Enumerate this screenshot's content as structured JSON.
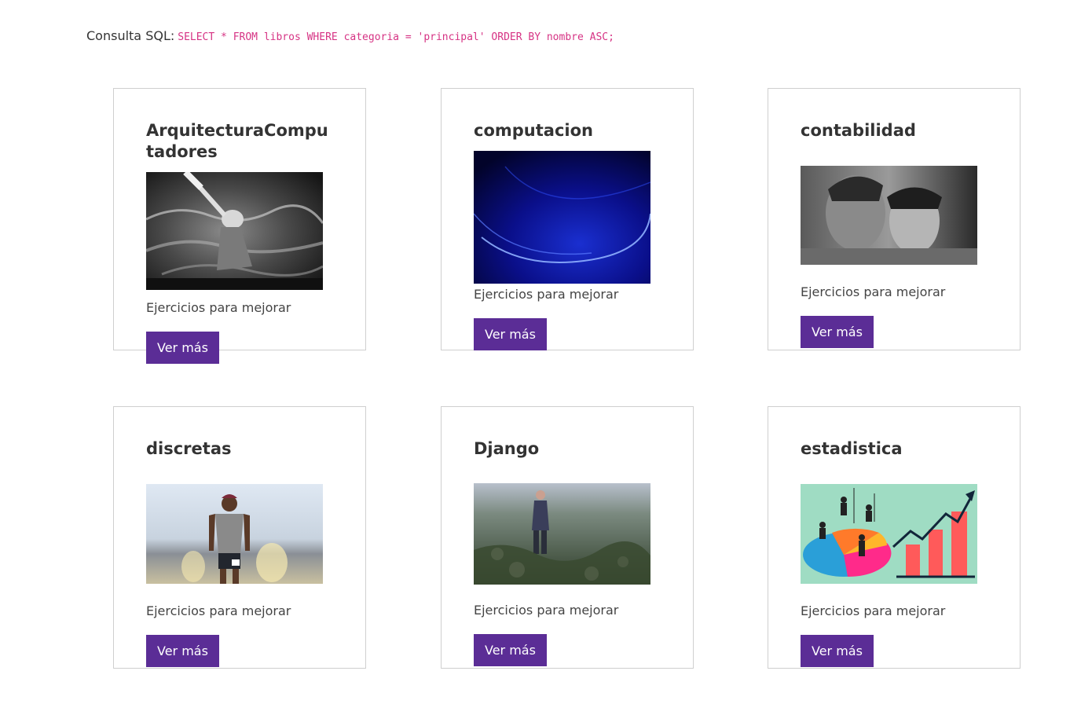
{
  "query": {
    "label": "Consulta SQL:",
    "sql": "SELECT * FROM libros WHERE categoria = 'principal' ORDER BY nombre ASC;"
  },
  "cards": [
    {
      "title": "ArquitecturaComputadores",
      "description": "Ejercicios para mejorar",
      "button": "Ver más"
    },
    {
      "title": "computacion",
      "description": "Ejercicios para mejorar",
      "button": "Ver más"
    },
    {
      "title": "contabilidad",
      "description": "Ejercicios para mejorar",
      "button": "Ver más"
    },
    {
      "title": "discretas",
      "description": "Ejercicios para mejorar",
      "button": "Ver más"
    },
    {
      "title": "Django",
      "description": "Ejercicios para mejorar",
      "button": "Ver más"
    },
    {
      "title": "estadistica",
      "description": "Ejercicios para mejorar",
      "button": "Ver más"
    }
  ],
  "colors": {
    "button_bg": "#5b2d96",
    "sql_text": "#d63384",
    "card_border": "#cfcfcf"
  }
}
